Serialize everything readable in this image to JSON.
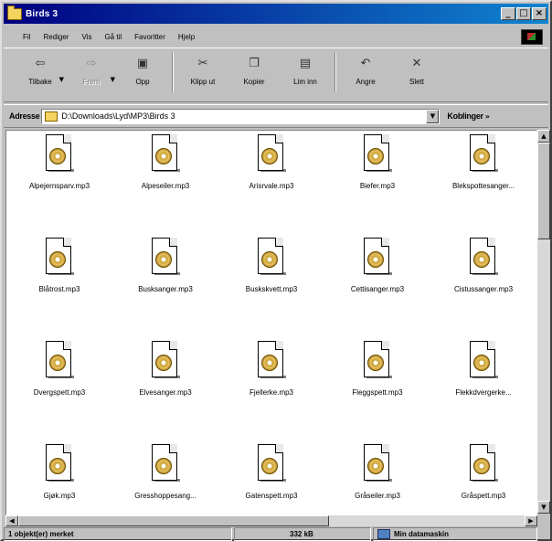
{
  "window": {
    "title": "Birds 3"
  },
  "menu": [
    "Fil",
    "Rediger",
    "Vis",
    "Gå til",
    "Favoritter",
    "Hjelp"
  ],
  "toolbar": [
    {
      "label": "Tilbake",
      "icon": "back-arrow-icon",
      "glyph": "⇦",
      "disabled": false,
      "dropdown": true
    },
    {
      "label": "Frem",
      "icon": "forward-arrow-icon",
      "glyph": "⇨",
      "disabled": true,
      "dropdown": true
    },
    {
      "label": "Opp",
      "icon": "up-folder-icon",
      "glyph": "▣",
      "disabled": false,
      "dropdown": false
    },
    {
      "label": "Klipp ut",
      "icon": "scissors-icon",
      "glyph": "✂",
      "disabled": false,
      "dropdown": false
    },
    {
      "label": "Kopier",
      "icon": "copy-icon",
      "glyph": "❐",
      "disabled": false,
      "dropdown": false
    },
    {
      "label": "Lim inn",
      "icon": "paste-icon",
      "glyph": "▤",
      "disabled": false,
      "dropdown": false
    },
    {
      "label": "Angre",
      "icon": "undo-icon",
      "glyph": "↶",
      "disabled": false,
      "dropdown": false
    },
    {
      "label": "Slett",
      "icon": "delete-icon",
      "glyph": "✕",
      "disabled": false,
      "dropdown": false
    }
  ],
  "address": {
    "label": "Adresse",
    "path": "D:\\Downloads\\Lyd\\MP3\\Birds 3",
    "links_label": "Koblinger"
  },
  "files": [
    "Alpejernsparv.mp3",
    "Alpeseiler.mp3",
    "Arisrvale.mp3",
    "Biefer.mp3",
    "Blekspottesanger...",
    "Blåtrost.mp3",
    "Busksanger.mp3",
    "Buskskvett.mp3",
    "Cettisanger.mp3",
    "Cistussanger.mp3",
    "Dvergspett.mp3",
    "Elvesanger.mp3",
    "Fjellerke.mp3",
    "Fleggspett.mp3",
    "Flekkdvergerke...",
    "Gjøk.mp3",
    "Gresshoppesang...",
    "Gatenspett.mp3",
    "Gråseiler.mp3",
    "Gråspett.mp3"
  ],
  "status": {
    "selection": "1 objekt(er) merket",
    "size": "332 kB",
    "zone": "Min datamaskin"
  }
}
